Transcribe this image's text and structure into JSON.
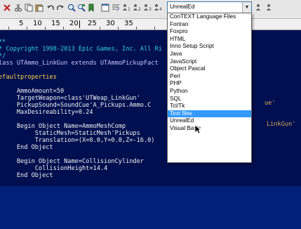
{
  "toolbar": {
    "icons": [
      "close-file",
      "cut",
      "copy",
      "paste",
      "undo",
      "redo",
      "find",
      "replace",
      "bookmark",
      "new-window",
      "word-wrap",
      "show-spaces",
      "user-tool-1",
      "user-tool-2",
      "user-tool-3",
      "user-tool-4",
      "user-tool-5",
      "user-tool-6"
    ]
  },
  "language_selector": {
    "selected": "UnrealEd",
    "options": [
      "ConTEXT Language Files",
      "Fortran",
      "Foxpro",
      "HTML",
      "Inno Setup Script",
      "Java",
      "JavaScript",
      "Object Pascal",
      "Perl",
      "PHP",
      "Python",
      "SQL",
      "Tcl/Tk",
      "Text files",
      "UnrealEd",
      "Visual Basic"
    ],
    "highlighted": "Text files"
  },
  "ruler": {
    "labels": [
      "5",
      "10",
      "15",
      "20",
      "25",
      "30",
      "35"
    ]
  },
  "editor": {
    "lines": [
      {
        "text": "**",
        "cls": "c-comment"
      },
      {
        "text": "* Copyright 1998-2013 Epic Games, Inc. All Ri",
        "cls": "c-comment"
      },
      {
        "text": "*/",
        "cls": "c-comment"
      },
      {
        "text": "lass UTAmmo_LinkGun extends UTAmmoPickupFact",
        "cls": "c-key"
      },
      {
        "text": "",
        "cls": "c-plain"
      },
      {
        "text": "efaultproperties",
        "cls": "c-section"
      },
      {
        "text": "",
        "cls": "c-plain"
      },
      {
        "text": "     AmmoAmount=50",
        "cls": "c-plain"
      },
      {
        "text": "     TargetWeapon=class'UTWeap_LinkGun'",
        "cls": "c-plain"
      },
      {
        "text": "     PickupSound=SoundCue'A_Pickups.Ammo.C",
        "cls": "c-plain"
      },
      {
        "text": "     MaxDesireability=0.24",
        "cls": "c-plain"
      },
      {
        "text": "",
        "cls": "c-plain"
      },
      {
        "text": "     Begin Object Name=AmmoMeshComp",
        "cls": "c-plain"
      },
      {
        "text": "          StaticMesh=StaticMesh'Pickups",
        "cls": "c-plain"
      },
      {
        "text": "          Translation=(X=0.0,Y=0.0,Z=-16.0)",
        "cls": "c-plain"
      },
      {
        "text": "     End Object",
        "cls": "c-plain"
      },
      {
        "text": "",
        "cls": "c-plain"
      },
      {
        "text": "     Begin Object Name=CollisionCylinder",
        "cls": "c-plain"
      },
      {
        "text": "          CollisionHeight=14.4",
        "cls": "c-plain"
      },
      {
        "text": "     End Object",
        "cls": "c-plain"
      }
    ],
    "right_fragments": {
      "pickup_sound_tail": "ue'",
      "static_mesh_tail": "LinkGun'"
    }
  },
  "colors": {
    "background": "#000f4f",
    "comment": "#34cfe0",
    "keyword": "#c9c9ff",
    "section": "#ffd84a",
    "string": "#d8a85a",
    "highlight": "#3399ff"
  }
}
